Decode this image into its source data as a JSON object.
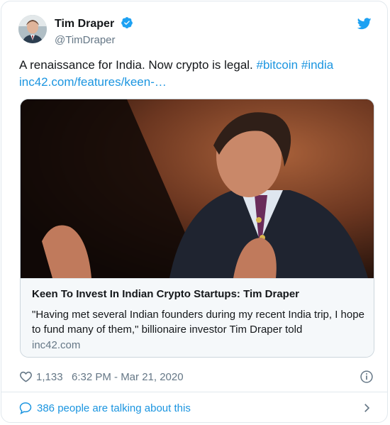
{
  "author": {
    "display_name": "Tim Draper",
    "handle": "@TimDraper",
    "verified": true
  },
  "tweet": {
    "text": "A renaissance for India. Now crypto is legal.",
    "hashtags": [
      "#bitcoin",
      "#india"
    ],
    "link": "inc42.com/features/keen-…"
  },
  "card": {
    "title": "Keen To Invest In Indian Crypto Startups: Tim Draper",
    "description": "\"Having met several Indian founders during my recent India trip, I hope to fund many of them,\" billionaire investor Tim Draper told",
    "domain": "inc42.com"
  },
  "stats": {
    "likes": "1,133",
    "timestamp": "6:32 PM - Mar 21, 2020"
  },
  "footer": {
    "talking": "386 people are talking about this"
  },
  "colors": {
    "link": "#1b95e0",
    "verified": "#1da1f2",
    "muted": "#657786"
  },
  "icons": [
    "verified-badge-icon",
    "twitter-bird-icon",
    "heart-icon",
    "info-icon",
    "comment-bubble-icon",
    "chevron-right-icon"
  ]
}
